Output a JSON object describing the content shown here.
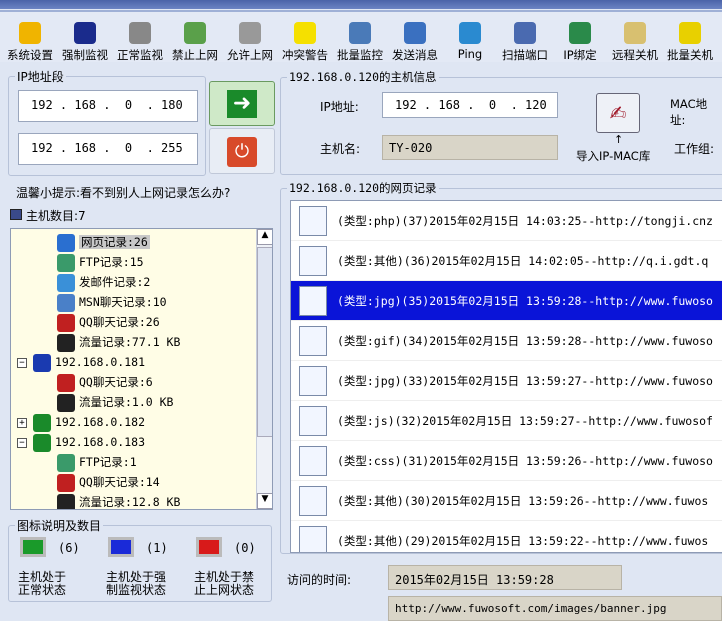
{
  "toolbar": [
    {
      "label": "系统设置",
      "icon": "settings-icon",
      "color": "#f0b400"
    },
    {
      "label": "强制监视",
      "icon": "monitor-icon",
      "color": "#1a2b8c"
    },
    {
      "label": "正常监视",
      "icon": "monitor-normal-icon",
      "color": "#888"
    },
    {
      "label": "禁止上网",
      "icon": "block-network-icon",
      "color": "#5aa04a"
    },
    {
      "label": "允许上网",
      "icon": "allow-network-icon",
      "color": "#999"
    },
    {
      "label": "冲突警告",
      "icon": "warning-icon",
      "color": "#f5e000"
    },
    {
      "label": "批量监控",
      "icon": "batch-monitor-icon",
      "color": "#4a7ab8"
    },
    {
      "label": "发送消息",
      "icon": "message-icon",
      "color": "#3a70c0"
    },
    {
      "label": "Ping",
      "icon": "ping-icon",
      "color": "#2a8ad0"
    },
    {
      "label": "扫描端口",
      "icon": "scan-port-icon",
      "color": "#4a6ab0"
    },
    {
      "label": "IP绑定",
      "icon": "ip-bind-icon",
      "color": "#2a8a4a"
    },
    {
      "label": "远程关机",
      "icon": "remote-shutdown-icon",
      "color": "#d8c070"
    },
    {
      "label": "批量关机",
      "icon": "batch-shutdown-icon",
      "color": "#e8d000"
    }
  ],
  "ip_range": {
    "label": "IP地址段",
    "start": "192 . 168 .  0  . 180",
    "end": "192 . 168 .  0  . 255"
  },
  "host_info": {
    "title": "192.168.0.120的主机信息",
    "ip_label": "IP地址:",
    "ip": "192 . 168 .  0  . 120",
    "host_label": "主机名:",
    "host": "TY-020",
    "import_label": "导入IP-MAC库",
    "mac_label": "MAC地址:",
    "workgroup_label": "工作组:"
  },
  "tip": "温馨小提示:看不到别人上网记录怎么办?",
  "host_count": "主机数目:7",
  "tree": [
    {
      "level": 2,
      "text": "网页记录:26",
      "icon": "ie-icon",
      "color": "#2a6fd0",
      "selected": true
    },
    {
      "level": 2,
      "text": "FTP记录:15",
      "icon": "ftp-icon",
      "color": "#3a9a6a"
    },
    {
      "level": 2,
      "text": "发邮件记录:2",
      "icon": "mail-icon",
      "color": "#3a90d8"
    },
    {
      "level": 2,
      "text": "MSN聊天记录:10",
      "icon": "msn-icon",
      "color": "#4a80c8"
    },
    {
      "level": 2,
      "text": "QQ聊天记录:26",
      "icon": "qq-icon",
      "color": "#c02020"
    },
    {
      "level": 2,
      "text": "流量记录:77.1 KB",
      "icon": "traffic-icon",
      "color": "#222"
    },
    {
      "level": 1,
      "text": "192.168.0.181",
      "icon": "host-icon",
      "color": "#1a3ab0",
      "expand": "−"
    },
    {
      "level": 2,
      "text": "QQ聊天记录:6",
      "icon": "qq-icon",
      "color": "#c02020"
    },
    {
      "level": 2,
      "text": "流量记录:1.0 KB",
      "icon": "traffic-icon",
      "color": "#222"
    },
    {
      "level": 1,
      "text": "192.168.0.182",
      "icon": "host-icon",
      "color": "#1a8a2a",
      "expand": "+"
    },
    {
      "level": 1,
      "text": "192.168.0.183",
      "icon": "host-icon",
      "color": "#1a8a2a",
      "expand": "−"
    },
    {
      "level": 2,
      "text": "FTP记录:1",
      "icon": "ftp-icon",
      "color": "#3a9a6a"
    },
    {
      "level": 2,
      "text": "QQ聊天记录:14",
      "icon": "qq-icon",
      "color": "#c02020"
    },
    {
      "level": 2,
      "text": "流量记录:12.8 KB",
      "icon": "traffic-icon",
      "color": "#222"
    }
  ],
  "legend": {
    "title": "图标说明及数目",
    "items": [
      {
        "count": "(6)",
        "line1": "主机处于",
        "line2": "正常状态",
        "color": "#1a9a2a"
      },
      {
        "count": "(1)",
        "line1": "主机处于强",
        "line2": "制监视状态",
        "color": "#1a2ad8"
      },
      {
        "count": "(0)",
        "line1": "主机处于禁",
        "line2": "止上网状态",
        "color": "#d81a1a"
      }
    ]
  },
  "records": {
    "title": "192.168.0.120的网页记录",
    "rows": [
      {
        "text": "(类型:php)(37)2015年02月15日  14:03:25--http://tongji.cnz",
        "icon": "php-file-icon"
      },
      {
        "text": "(类型:其他)(36)2015年02月15日  14:02:05--http://q.i.gdt.q",
        "icon": "generic-file-icon"
      },
      {
        "text": "(类型:jpg)(35)2015年02月15日  13:59:28--http://www.fuwoso",
        "icon": "jpg-file-icon",
        "selected": true
      },
      {
        "text": "(类型:gif)(34)2015年02月15日  13:59:28--http://www.fuwoso",
        "icon": "gif-file-icon"
      },
      {
        "text": "(类型:jpg)(33)2015年02月15日  13:59:27--http://www.fuwoso",
        "icon": "jpg-file-icon"
      },
      {
        "text": "(类型:js)(32)2015年02月15日  13:59:27--http://www.fuwosof",
        "icon": "js-file-icon"
      },
      {
        "text": "(类型:css)(31)2015年02月15日  13:59:26--http://www.fuwoso",
        "icon": "css-file-icon"
      },
      {
        "text": "(类型:其他)(30)2015年02月15日  13:59:26--http://www.fuwos",
        "icon": "generic-file-icon"
      },
      {
        "text": "(类型:其他)(29)2015年02月15日  13:59:22--http://www.fuwos",
        "icon": "generic-file-icon"
      }
    ]
  },
  "visit": {
    "label": "访问的时间:",
    "value": "2015年02月15日  13:59:28",
    "url": "http://www.fuwosoft.com/images/banner.jpg"
  }
}
